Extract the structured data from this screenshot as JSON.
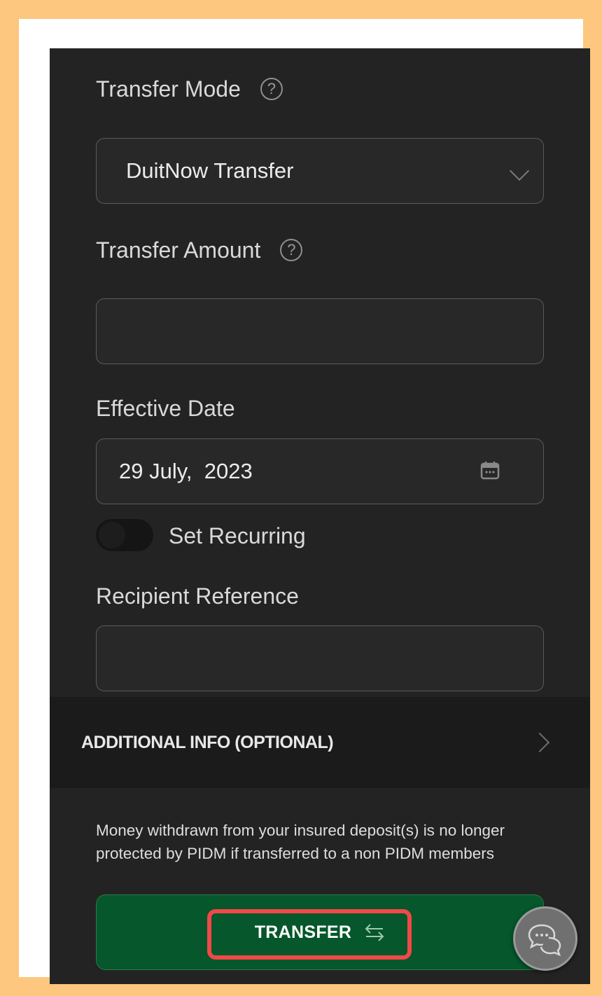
{
  "form": {
    "transfer_mode": {
      "label": "Transfer Mode",
      "help_icon": "question-circle-icon",
      "value": "DuitNow Transfer",
      "dropdown_icon": "chevron-down-icon"
    },
    "transfer_amount": {
      "label": "Transfer Amount",
      "help_icon": "question-circle-icon",
      "value": ""
    },
    "effective_date": {
      "label": "Effective Date",
      "value": "29 July,  2023",
      "icon": "calendar-icon"
    },
    "recurring": {
      "label": "Set Recurring",
      "enabled": false
    },
    "recipient_reference": {
      "label": "Recipient Reference",
      "value": ""
    }
  },
  "additional_info": {
    "title": "ADDITIONAL INFO (OPTIONAL)",
    "icon": "chevron-right-icon"
  },
  "disclaimer": "Money withdrawn from your insured deposit(s) is no longer protected by PIDM if transferred to a non PIDM members",
  "actions": {
    "transfer_label": "TRANSFER",
    "transfer_icon": "swap-arrows-icon",
    "chat_icon": "chat-bubbles-icon"
  },
  "colors": {
    "background": "#232323",
    "primary_button": "#06572b",
    "highlight": "#f24848"
  }
}
